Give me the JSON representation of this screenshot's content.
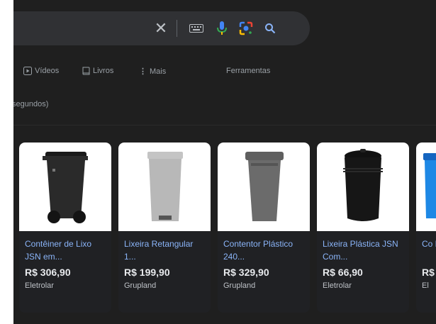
{
  "search": {
    "clear_icon": "close-icon",
    "keyboard_icon": "keyboard-icon",
    "mic_icon": "mic-icon",
    "lens_icon": "lens-icon",
    "search_icon": "search-icon"
  },
  "tabs": [
    {
      "label": "Vídeos",
      "icon": "video-icon"
    },
    {
      "label": "Livros",
      "icon": "book-icon"
    },
    {
      "label": "Mais",
      "icon": "more-vert-icon"
    },
    {
      "label": "Ferramentas"
    }
  ],
  "result_stats": "segundos)",
  "products": [
    {
      "title": "Contêiner de Lixo JSN em...",
      "price": "R$ 306,90",
      "store": "Eletrolar"
    },
    {
      "title": "Lixeira Retangular 1...",
      "price": "R$ 199,90",
      "store": "Grupland"
    },
    {
      "title": "Contentor Plástico 240...",
      "price": "R$ 329,90",
      "store": "Grupland"
    },
    {
      "title": "Lixeira Plástica JSN Com...",
      "price": "R$ 66,90",
      "store": "Eletrolar"
    },
    {
      "title": "Co Lix...",
      "price": "R$",
      "store": "El"
    }
  ],
  "colors": {
    "background": "#1f1f1f",
    "search_bar": "#303134",
    "link": "#8ab4f8",
    "mic_blue": "#4285f4",
    "lens_yellow": "#fbbc04",
    "lens_green": "#34a853"
  }
}
